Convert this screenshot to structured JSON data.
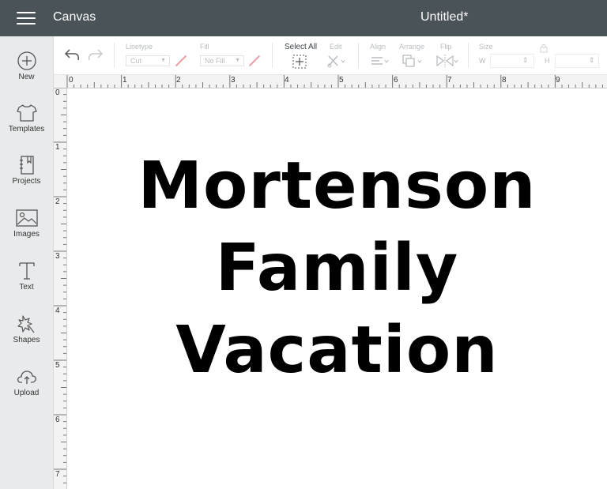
{
  "header": {
    "app_title": "Canvas",
    "document_title": "Untitled*"
  },
  "sidebar": {
    "items": [
      {
        "label": "New",
        "icon": "plus-circle-icon"
      },
      {
        "label": "Templates",
        "icon": "tshirt-icon"
      },
      {
        "label": "Projects",
        "icon": "notebook-icon"
      },
      {
        "label": "Images",
        "icon": "image-icon"
      },
      {
        "label": "Text",
        "icon": "text-t-icon"
      },
      {
        "label": "Shapes",
        "icon": "shapes-icon"
      },
      {
        "label": "Upload",
        "icon": "cloud-upload-icon"
      }
    ]
  },
  "toolbar": {
    "linetype_label": "Linetype",
    "linetype_value": "Cut",
    "fill_label": "Fill",
    "fill_value": "No Fill",
    "select_all_label": "Select All",
    "edit_label": "Edit",
    "align_label": "Align",
    "arrange_label": "Arrange",
    "flip_label": "Flip",
    "size_label": "Size",
    "width_label": "W",
    "height_label": "H"
  },
  "ruler": {
    "horizontal": [
      "0",
      "1",
      "2",
      "3",
      "4",
      "5",
      "6",
      "7",
      "8",
      "9"
    ],
    "vertical": [
      "0",
      "1",
      "2",
      "3",
      "4",
      "5",
      "6",
      "7"
    ]
  },
  "canvas": {
    "lines": [
      "Mortenson",
      "Family",
      "Vacation"
    ]
  },
  "colors": {
    "topbar": "#4a5357",
    "sidebar": "#e9eaeb",
    "slash_accent": "#e8a0a8"
  }
}
